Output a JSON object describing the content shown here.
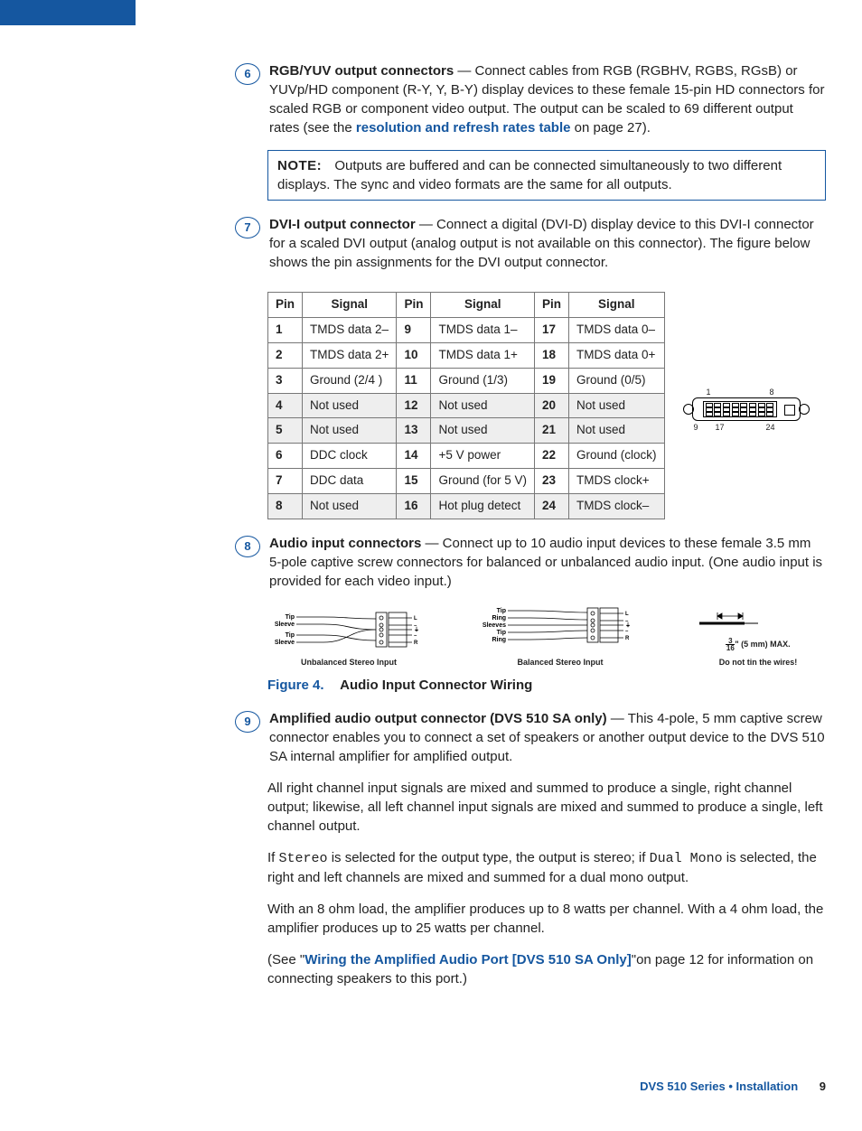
{
  "item6": {
    "num": "6",
    "title": "RGB/YUV output connectors",
    "text1": " — Connect cables from RGB (RGBHV, RGBS, RGsB) or YUVp/HD component (R-Y, Y, B-Y) display devices to these female 15-pin HD connectors for scaled RGB or component video output. The output can be scaled to 69 different output rates (see the ",
    "link": "resolution and refresh rates table",
    "text2": " on page 27)."
  },
  "note": {
    "label": "NOTE:",
    "text": "Outputs are buffered and can be connected simultaneously to two different displays. The sync and video formats are the same for all outputs."
  },
  "item7": {
    "num": "7",
    "title": "DVI-I output connector",
    "text": " — Connect a digital (DVI-D) display device to this DVI-I connector for a scaled DVI output (analog output is not available on this connector). The figure below shows the pin assignments for the DVI output connector."
  },
  "dvi_labels": {
    "tl": "1",
    "tr": "8",
    "bl": "9",
    "bc": "17",
    "br": "24"
  },
  "pins": {
    "headers": [
      "Pin",
      "Signal",
      "Pin",
      "Signal",
      "Pin",
      "Signal"
    ],
    "rows": [
      {
        "shaded": false,
        "cells": [
          "1",
          "TMDS data 2–",
          "9",
          "TMDS data 1–",
          "17",
          "TMDS data 0–"
        ]
      },
      {
        "shaded": false,
        "cells": [
          "2",
          "TMDS data 2+",
          "10",
          "TMDS data 1+",
          "18",
          "TMDS data 0+"
        ]
      },
      {
        "shaded": false,
        "cells": [
          "3",
          "Ground (2/4 )",
          "11",
          "Ground (1/3)",
          "19",
          "Ground (0/5)"
        ]
      },
      {
        "shaded": true,
        "cells": [
          "4",
          "Not used",
          "12",
          "Not used",
          "20",
          "Not used"
        ]
      },
      {
        "shaded": true,
        "cells": [
          "5",
          "Not used",
          "13",
          "Not used",
          "21",
          "Not used"
        ]
      },
      {
        "shaded": false,
        "cells": [
          "6",
          "DDC clock",
          "14",
          "+5 V power",
          "22",
          "Ground (clock)"
        ]
      },
      {
        "shaded": false,
        "cells": [
          "7",
          "DDC data",
          "15",
          "Ground (for 5 V)",
          "23",
          "TMDS clock+"
        ]
      },
      {
        "shaded": true,
        "cells": [
          "8",
          "Not used",
          "16",
          "Hot plug detect",
          "24",
          "TMDS clock–"
        ]
      }
    ]
  },
  "item8": {
    "num": "8",
    "title": "Audio input connectors",
    "text": " — Connect up to 10 audio input devices to these female 3.5 mm 5-pole captive screw connectors for balanced or unbalanced audio input. (One audio input is provided for each video input.)"
  },
  "figures": {
    "unbalanced": {
      "caption": "Unbalanced Stereo Input",
      "labels": [
        "Tip",
        "Sleeve",
        "Tip",
        "Sleeve"
      ],
      "terminals": [
        "L",
        "—",
        "⏚",
        "—",
        "R"
      ]
    },
    "balanced": {
      "caption": "Balanced Stereo Input",
      "labels": [
        "Tip",
        "Ring",
        "Sleeves",
        "Tip",
        "Ring"
      ],
      "terminals": [
        "L",
        "—",
        "⏚",
        "—",
        "R"
      ]
    },
    "wire": {
      "caption": "Do not tin the wires!",
      "measure": "(5 mm) MAX.",
      "frac_top": "3",
      "frac_bot": "16",
      "inch": "\""
    }
  },
  "figure_caption": {
    "label": "Figure 4.",
    "text": "Audio Input Connector Wiring"
  },
  "item9": {
    "num": "9",
    "title": "Amplified audio output connector (DVS 510 SA only)",
    "text": " — This 4-pole, 5 mm captive screw connector enables you to connect a set of speakers or another output device to the DVS 510 SA internal amplifier for amplified output.",
    "para2": "All right channel input signals are mixed and summed to produce a single, right channel output; likewise, all left channel input signals are mixed and summed to produce a single, left channel output.",
    "para3a": "If ",
    "mono1": "Stereo",
    "para3b": " is selected for the output type, the output is stereo; if ",
    "mono2": "Dual Mono",
    "para3c": " is selected, the right and left channels are mixed and summed for a dual mono output.",
    "para4": "With an 8 ohm load, the amplifier produces up to 8 watts per channel. With a 4 ohm load, the amplifier produces up to 25 watts per channel.",
    "para5a": "(See \"",
    "link": "Wiring the Amplified Audio Port [DVS 510 SA Only]",
    "para5b": "\"on page 12 for information on connecting speakers to this port.)"
  },
  "footer": {
    "title": "DVS 510 Series • Installation",
    "page": "9"
  }
}
